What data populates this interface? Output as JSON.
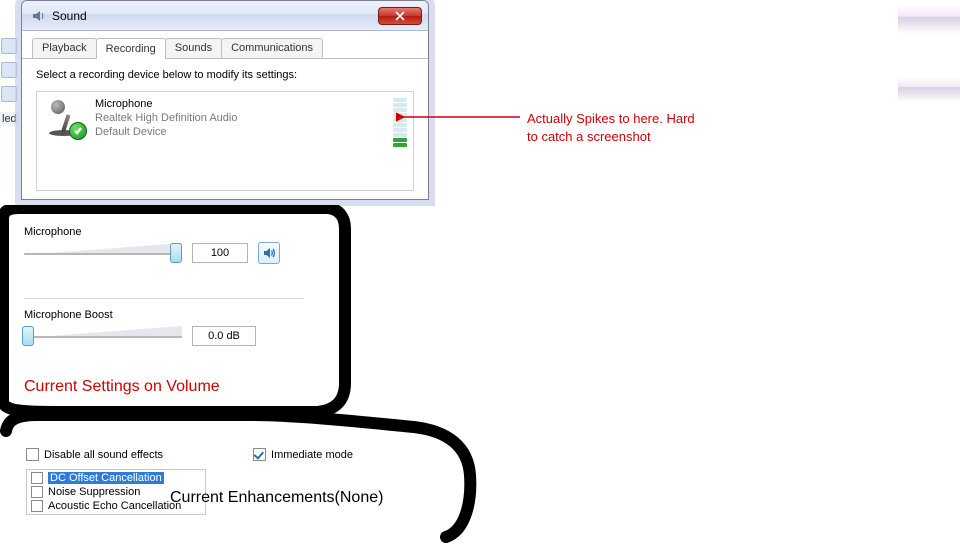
{
  "sound_dialog": {
    "title": "Sound",
    "tabs": {
      "playback": "Playback",
      "recording": "Recording",
      "sounds": "Sounds",
      "communications": "Communications"
    },
    "active_tab": "recording",
    "instruction": "Select a recording device below to modify its settings:",
    "device": {
      "name": "Microphone",
      "driver": "Realtek High Definition Audio",
      "status": "Default Device",
      "level_bars_on": 2,
      "level_bars_total": 10
    }
  },
  "annotation": {
    "spike_text": "Actually Spikes to here. Hard to catch a screenshot"
  },
  "volume_panel": {
    "mic_label": "Microphone",
    "mic_value": "100",
    "boost_label": "Microphone Boost",
    "boost_value": "0.0 dB",
    "caption": "Current Settings on Volume"
  },
  "enhancements": {
    "disable_all": {
      "label": "Disable all sound effects",
      "checked": false
    },
    "immediate": {
      "label": "Immediate mode",
      "checked": true
    },
    "items": {
      "dc": "DC Offset Cancellation",
      "noise": "Noise Suppression",
      "echo": "Acoustic Echo Cancellation"
    },
    "caption": "Current Enhancements(None)"
  },
  "left_label": "led"
}
